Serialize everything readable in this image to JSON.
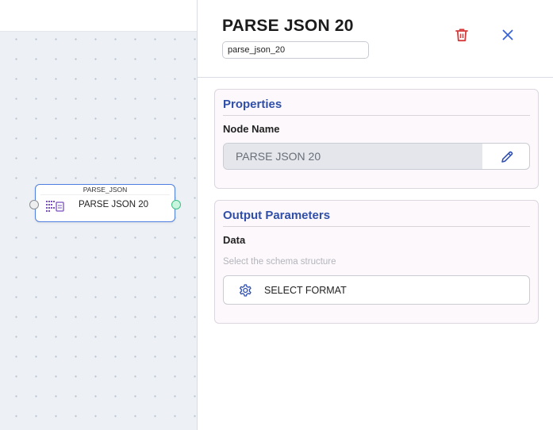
{
  "canvas": {
    "node": {
      "type_label": "PARSE_JSON",
      "label": "PARSE JSON 20",
      "icon": "json-parse-icon"
    }
  },
  "panel": {
    "title": "PARSE JSON 20",
    "node_id": "parse_json_20",
    "delete_icon": "trash-icon",
    "close_icon": "close-icon",
    "properties": {
      "title": "Properties",
      "node_name_label": "Node Name",
      "node_name_value": "PARSE JSON 20",
      "edit_icon": "pencil-icon"
    },
    "output_parameters": {
      "title": "Output Parameters",
      "data_label": "Data",
      "hint": "Select the schema structure",
      "select_button_label": "SELECT FORMAT",
      "select_button_icon": "gear-icon"
    }
  },
  "colors": {
    "accent_blue": "#2f4fa8",
    "node_border": "#4f7fe0",
    "delete_red": "#d63a3a",
    "close_blue": "#3a63d6",
    "output_port": "#3cbf83"
  }
}
